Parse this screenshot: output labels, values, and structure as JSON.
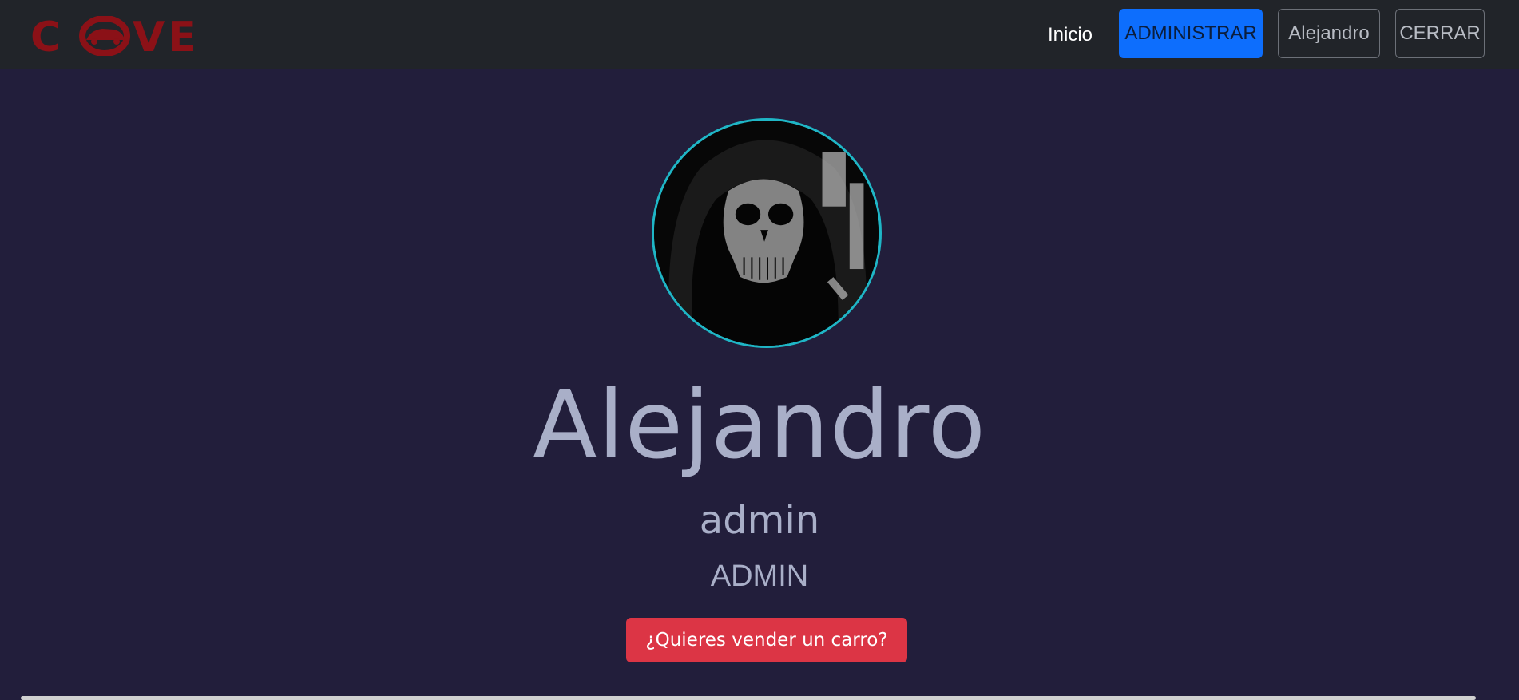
{
  "brand": {
    "name": "CAVE",
    "color": "#8b1117"
  },
  "nav": {
    "home_label": "Inicio",
    "admin_label": "ADMINISTRAR",
    "user_label": "Alejandro",
    "logout_label": "CERRAR"
  },
  "profile": {
    "display_name": "Alejandro",
    "username": "admin",
    "role": "ADMIN",
    "sell_button_label": "¿Quieres vender un carro?"
  },
  "colors": {
    "background": "#221e3b",
    "navbar": "#212429",
    "primary": "#0d6efd",
    "danger": "#dc3545",
    "avatar_ring": "#1fb6c6",
    "text_muted": "#a9afc8"
  }
}
